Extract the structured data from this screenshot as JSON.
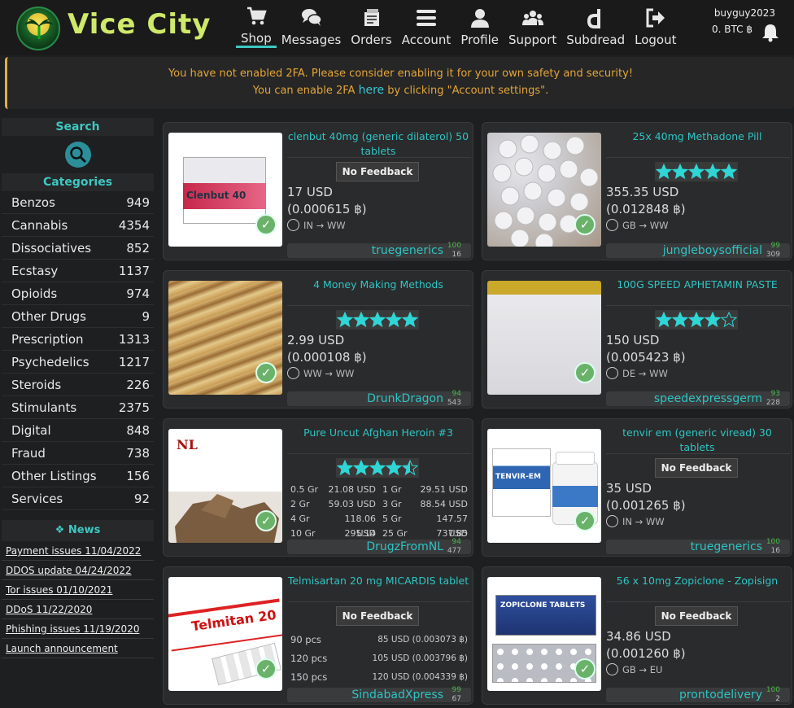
{
  "brand": {
    "name": "Vice City"
  },
  "nav": [
    {
      "label": "Shop",
      "icon": "cart-icon"
    },
    {
      "label": "Messages",
      "icon": "chat-icon"
    },
    {
      "label": "Orders",
      "icon": "orders-icon"
    },
    {
      "label": "Account",
      "icon": "menu-icon"
    },
    {
      "label": "Profile",
      "icon": "user-icon"
    },
    {
      "label": "Support",
      "icon": "users-icon"
    },
    {
      "label": "Subdread",
      "icon": "dread-icon"
    },
    {
      "label": "Logout",
      "icon": "logout-icon"
    }
  ],
  "user": {
    "name": "buyguy2023",
    "balance": "0. BTC ฿"
  },
  "alert": {
    "line1": "You have not enabled 2FA. Please consider enabling it for your own safety and security!",
    "line2_before": "You can enable 2FA ",
    "line2_link": "here",
    "line2_after": " by clicking \"Account settings\"."
  },
  "sidebar": {
    "search_title": "Search",
    "categories_title": "Categories",
    "categories": [
      {
        "name": "Benzos",
        "count": "949"
      },
      {
        "name": "Cannabis",
        "count": "4354"
      },
      {
        "name": "Dissociatives",
        "count": "852"
      },
      {
        "name": "Ecstasy",
        "count": "1137"
      },
      {
        "name": "Opioids",
        "count": "974"
      },
      {
        "name": "Other Drugs",
        "count": "9"
      },
      {
        "name": "Prescription",
        "count": "1313"
      },
      {
        "name": "Psychedelics",
        "count": "1217"
      },
      {
        "name": "Steroids",
        "count": "226"
      },
      {
        "name": "Stimulants",
        "count": "2375"
      },
      {
        "name": "Digital",
        "count": "848"
      },
      {
        "name": "Fraud",
        "count": "738"
      },
      {
        "name": "Other Listings",
        "count": "156"
      },
      {
        "name": "Services",
        "count": "92"
      }
    ],
    "news_title": "News",
    "news": [
      "Payment issues 11/04/2022",
      "DDOS update 04/24/2022",
      "Tor issues 01/10/2021",
      "DDoS 11/22/2020",
      "Phishing issues 11/19/2020",
      "Launch announcement"
    ]
  },
  "listings": [
    {
      "title": "clenbut 40mg (generic dilaterol) 50 tablets",
      "feedback": "No Feedback",
      "price_usd": "17 USD",
      "price_btc": "(0.000615 ฿)",
      "ship": "IN → WW",
      "vendor": "truegenerics",
      "vendor_pct": "100",
      "vendor_count": "16"
    },
    {
      "title": "25x 40mg Methadone Pill",
      "rating": 5,
      "price_usd": "355.35 USD",
      "price_btc": "(0.012848 ฿)",
      "ship": "GB → WW",
      "vendor": "jungleboysofficial",
      "vendor_pct": "99",
      "vendor_count": "309"
    },
    {
      "title": "4 Money Making Methods",
      "rating": 5,
      "price_usd": "2.99 USD",
      "price_btc": "(0.000108 ฿)",
      "ship": "WW → WW",
      "vendor": "DrunkDragon",
      "vendor_pct": "94",
      "vendor_count": "543"
    },
    {
      "title": "100G SPEED APHETAMIN PASTE",
      "rating": 4,
      "price_usd": "150 USD",
      "price_btc": "(0.005423 ฿)",
      "ship": "DE → WW",
      "vendor": "speedexpressgerm",
      "vendor_pct": "93",
      "vendor_count": "228"
    },
    {
      "title": "Pure Uncut Afghan Heroin #3",
      "rating": 4.5,
      "tiers": [
        [
          "0.5 Gr",
          "21.08 USD",
          "1 Gr",
          "29.51 USD"
        ],
        [
          "2 Gr",
          "59.03 USD",
          "3 Gr",
          "88.54 USD"
        ],
        [
          "4 Gr",
          "118.06 USD",
          "5 Gr",
          "147.57 USD"
        ],
        [
          "10 Gr",
          "295.14 USD",
          "25 Gr",
          "737.85 USD"
        ]
      ],
      "vendor": "DrugzFromNL",
      "vendor_pct": "94",
      "vendor_count": "477"
    },
    {
      "title": "tenvir em (generic viread) 30 tablets",
      "feedback": "No Feedback",
      "price_usd": "35 USD",
      "price_btc": "(0.001265 ฿)",
      "ship": "IN → WW",
      "vendor": "truegenerics",
      "vendor_pct": "100",
      "vendor_count": "16"
    },
    {
      "title": "Telmisartan 20 mg MICARDIS tablet",
      "feedback": "No Feedback",
      "options": [
        [
          "90 pcs",
          "85 USD (0.003073 ฿)"
        ],
        [
          "120 pcs",
          "105 USD (0.003796 ฿)"
        ],
        [
          "150 pcs",
          "120 USD (0.004339 ฿)"
        ]
      ],
      "vendor": "SindabadXpress",
      "vendor_pct": "99",
      "vendor_count": "67"
    },
    {
      "title": "56 x 10mg Zopiclone - Zopisign",
      "feedback": "No Feedback",
      "price_usd": "34.86 USD",
      "price_btc": "(0.001260 ฿)",
      "ship": "GB → EU",
      "vendor": "prontodelivery",
      "vendor_pct": "100",
      "vendor_count": "2"
    }
  ],
  "thumb_labels": {
    "clenbut": "Clenbut 40",
    "nl": "NL",
    "tenvir": "TENVIR-EM",
    "telmitan": "Telmitan 20",
    "zopiclone": "ZOPICLONE TABLETS"
  }
}
